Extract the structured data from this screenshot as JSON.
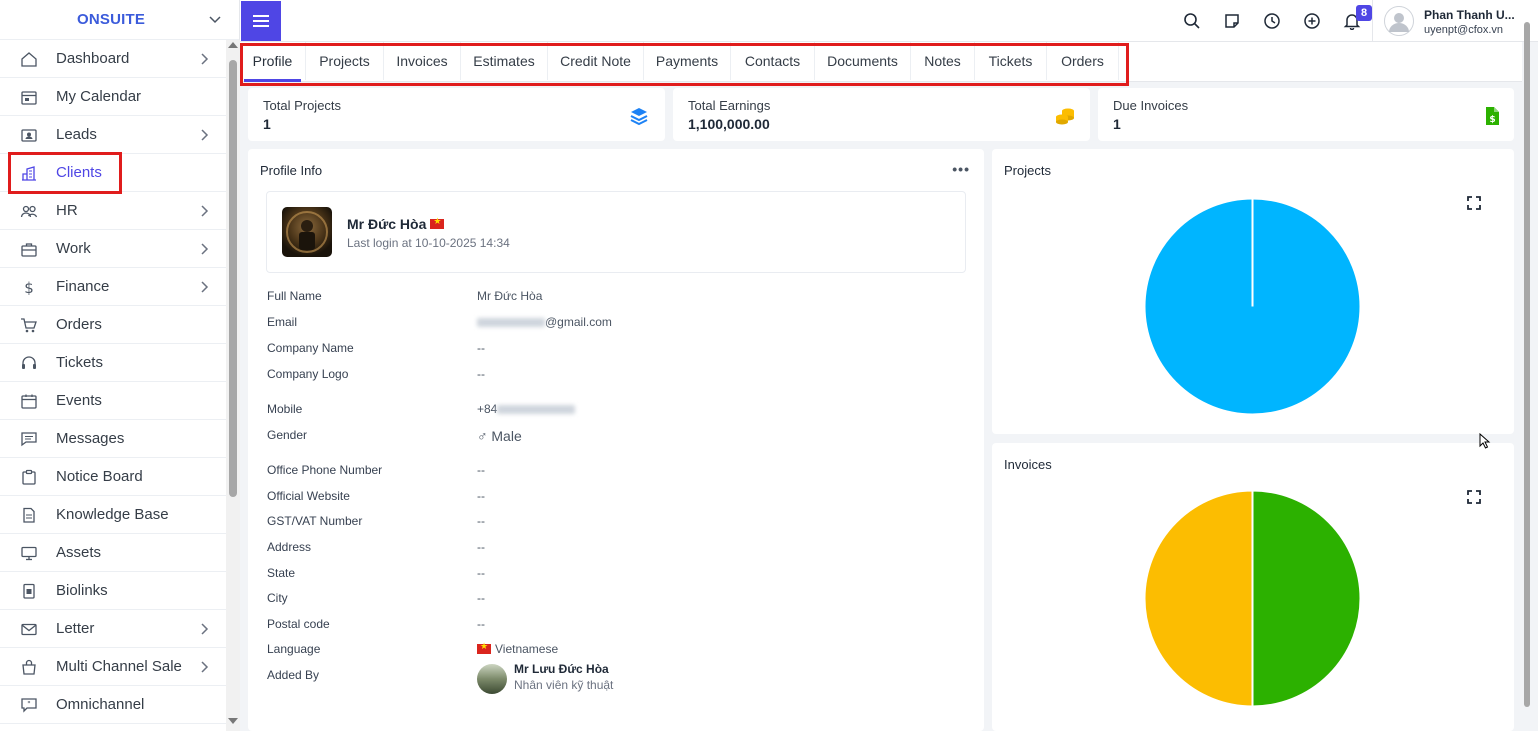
{
  "brand": {
    "name": "ONSUITE"
  },
  "sidebar": {
    "items": [
      {
        "label": "Dashboard",
        "icon": "home-icon",
        "chevron": true
      },
      {
        "label": "My Calendar",
        "icon": "calendar-icon",
        "chevron": false
      },
      {
        "label": "Leads",
        "icon": "id-card-icon",
        "chevron": true
      },
      {
        "label": "Clients",
        "icon": "building-icon",
        "chevron": false,
        "active": true
      },
      {
        "label": "HR",
        "icon": "people-icon",
        "chevron": true
      },
      {
        "label": "Work",
        "icon": "briefcase-icon",
        "chevron": true
      },
      {
        "label": "Finance",
        "icon": "dollar-icon",
        "chevron": true
      },
      {
        "label": "Orders",
        "icon": "cart-icon",
        "chevron": false
      },
      {
        "label": "Tickets",
        "icon": "headset-icon",
        "chevron": false
      },
      {
        "label": "Events",
        "icon": "calendar-event-icon",
        "chevron": false
      },
      {
        "label": "Messages",
        "icon": "chat-icon",
        "chevron": false
      },
      {
        "label": "Notice Board",
        "icon": "clipboard-icon",
        "chevron": false
      },
      {
        "label": "Knowledge Base",
        "icon": "document-icon",
        "chevron": false
      },
      {
        "label": "Assets",
        "icon": "monitor-icon",
        "chevron": false
      },
      {
        "label": "Biolinks",
        "icon": "badge-icon",
        "chevron": false
      },
      {
        "label": "Letter",
        "icon": "envelope-icon",
        "chevron": true
      },
      {
        "label": "Multi Channel Sale",
        "icon": "bag-icon",
        "chevron": true
      },
      {
        "label": "Omnichannel",
        "icon": "chat-quote-icon",
        "chevron": false
      }
    ]
  },
  "header": {
    "notification_count": "8",
    "user_name": "Phan Thanh U...",
    "user_email": "uyenpt@cfox.vn"
  },
  "tabs": [
    {
      "label": "Profile",
      "active": true
    },
    {
      "label": "Projects"
    },
    {
      "label": "Invoices"
    },
    {
      "label": "Estimates"
    },
    {
      "label": "Credit Note"
    },
    {
      "label": "Payments"
    },
    {
      "label": "Contacts"
    },
    {
      "label": "Documents"
    },
    {
      "label": "Notes"
    },
    {
      "label": "Tickets"
    },
    {
      "label": "Orders"
    }
  ],
  "stats": [
    {
      "label": "Total Projects",
      "value": "1",
      "icon": "layers-icon",
      "color": "#1d82f5"
    },
    {
      "label": "Total Earnings",
      "value": "1,100,000.00",
      "icon": "coins-icon",
      "color": "#fcbd01"
    },
    {
      "label": "Due Invoices",
      "value": "1",
      "icon": "invoice-dollar-icon",
      "color": "#2cb100"
    }
  ],
  "profile": {
    "card_title": "Profile Info",
    "name": "Mr Đức Hòa",
    "last_login": "Last login at 10-10-2025 14:34",
    "fields": [
      {
        "label": "Full Name",
        "value": "Mr Đức Hòa"
      },
      {
        "label": "Email",
        "value": "@gmail.com",
        "blurred_prefix": true
      },
      {
        "label": "Company Name",
        "value": "--"
      },
      {
        "label": "Company Logo",
        "value": "--"
      },
      {
        "label": "Mobile",
        "value": "+84",
        "blurred_suffix": true
      },
      {
        "label": "Gender",
        "value": "♂ Male"
      },
      {
        "label": "Office Phone Number",
        "value": "--"
      },
      {
        "label": "Official Website",
        "value": "--"
      },
      {
        "label": "GST/VAT Number",
        "value": "--"
      },
      {
        "label": "Address",
        "value": "--"
      },
      {
        "label": "State",
        "value": "--"
      },
      {
        "label": "City",
        "value": "--"
      },
      {
        "label": "Postal code",
        "value": "--"
      },
      {
        "label": "Language",
        "value": "Vietnamese",
        "flag": true
      },
      {
        "label": "Added By",
        "value": ""
      }
    ],
    "added_by": {
      "name": "Mr Lưu Đức Hòa",
      "role": "Nhân viên kỹ thuật"
    }
  },
  "projects_chart": {
    "title": "Projects",
    "chart_data": {
      "type": "pie",
      "values": [
        100
      ],
      "colors": [
        "#00b5ff"
      ]
    }
  },
  "invoices_chart": {
    "title": "Invoices",
    "chart_data": {
      "type": "pie",
      "values": [
        50,
        50
      ],
      "colors": [
        "#2cb100",
        "#fcbd01"
      ]
    }
  },
  "colors": {
    "accent": "#4f46e5",
    "highlight": "#e01c1c"
  }
}
